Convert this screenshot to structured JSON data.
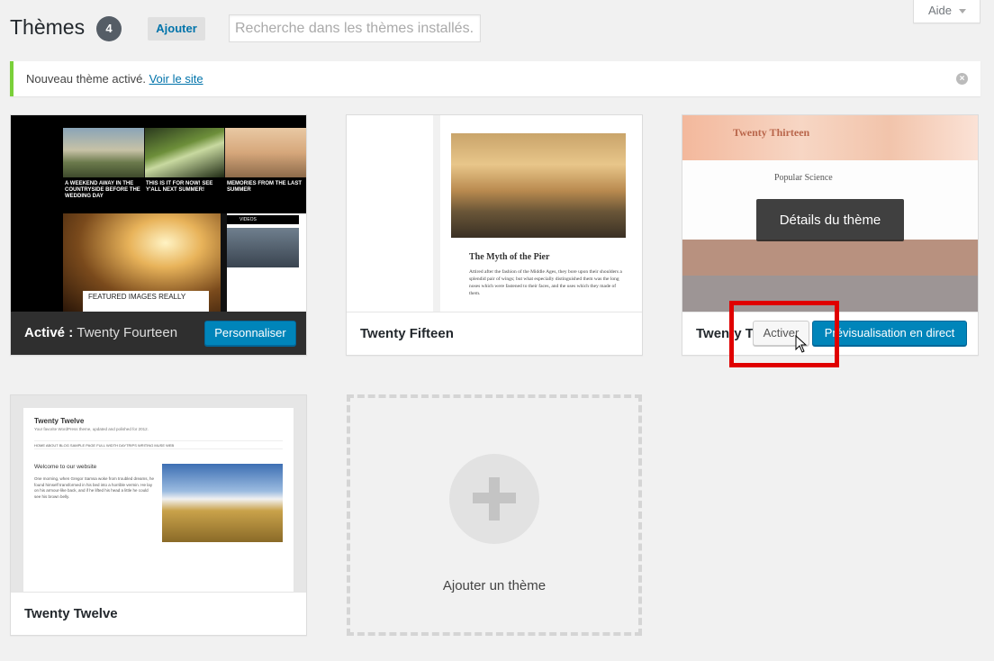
{
  "header": {
    "title": "Thèmes",
    "count": "4",
    "add_label": "Ajouter",
    "search_placeholder": "Recherche dans les thèmes installés...",
    "help_label": "Aide"
  },
  "notice": {
    "text": "Nouveau thème activé.",
    "link": "Voir le site"
  },
  "themes": [
    {
      "name": "Twenty Fourteen",
      "active_prefix": "Activé :",
      "customize_label": "Personnaliser",
      "screenshot": {
        "captions": [
          "A WEEKEND AWAY IN THE COUNTRYSIDE BEFORE THE WEDDING DAY",
          "THIS IS IT FOR NOW! SEE Y'ALL NEXT SUMMER!",
          "MEMORIES FROM THE LAST SUMMER"
        ],
        "feature_label": "FEATURED IMAGES REALLY",
        "widget_header": "VIDEOS"
      }
    },
    {
      "name": "Twenty Fifteen",
      "screenshot": {
        "article_title": "The Myth of the Pier",
        "article_text": "Attired after the fashion of the Middle Ages, they bore upon their shoulders a splendid pair of wings; but what especially distinguished them was the long noses which were fastened to their faces, and the uses which they made of them."
      }
    },
    {
      "name": "Twenty T",
      "details_label": "Détails du thème",
      "activate_label": "Activer",
      "preview_label": "Prévisualisation en direct",
      "screenshot": {
        "site_title": "Twenty Thirteen",
        "post_title": "Popular Science"
      }
    },
    {
      "name": "Twenty Twelve",
      "screenshot": {
        "site_title": "Twenty Twelve",
        "tagline": "Your favorite WordPress theme, updated and polished for 2012.",
        "nav": "HOME     ABOUT     BLOG     SAMPLE PAGE     FULL WIDTH     DAYTRIPS     WRITING     MUSE     WEB",
        "welcome": "Welcome to our website",
        "text": "One morning, when Gregor Samsa woke from troubled dreams, he found himself transformed in his bed into a horrible vermin. He lay on his armour-like back, and if he lifted his head a little he could see his brown belly."
      }
    }
  ],
  "add_theme": {
    "label": "Ajouter un thème"
  }
}
